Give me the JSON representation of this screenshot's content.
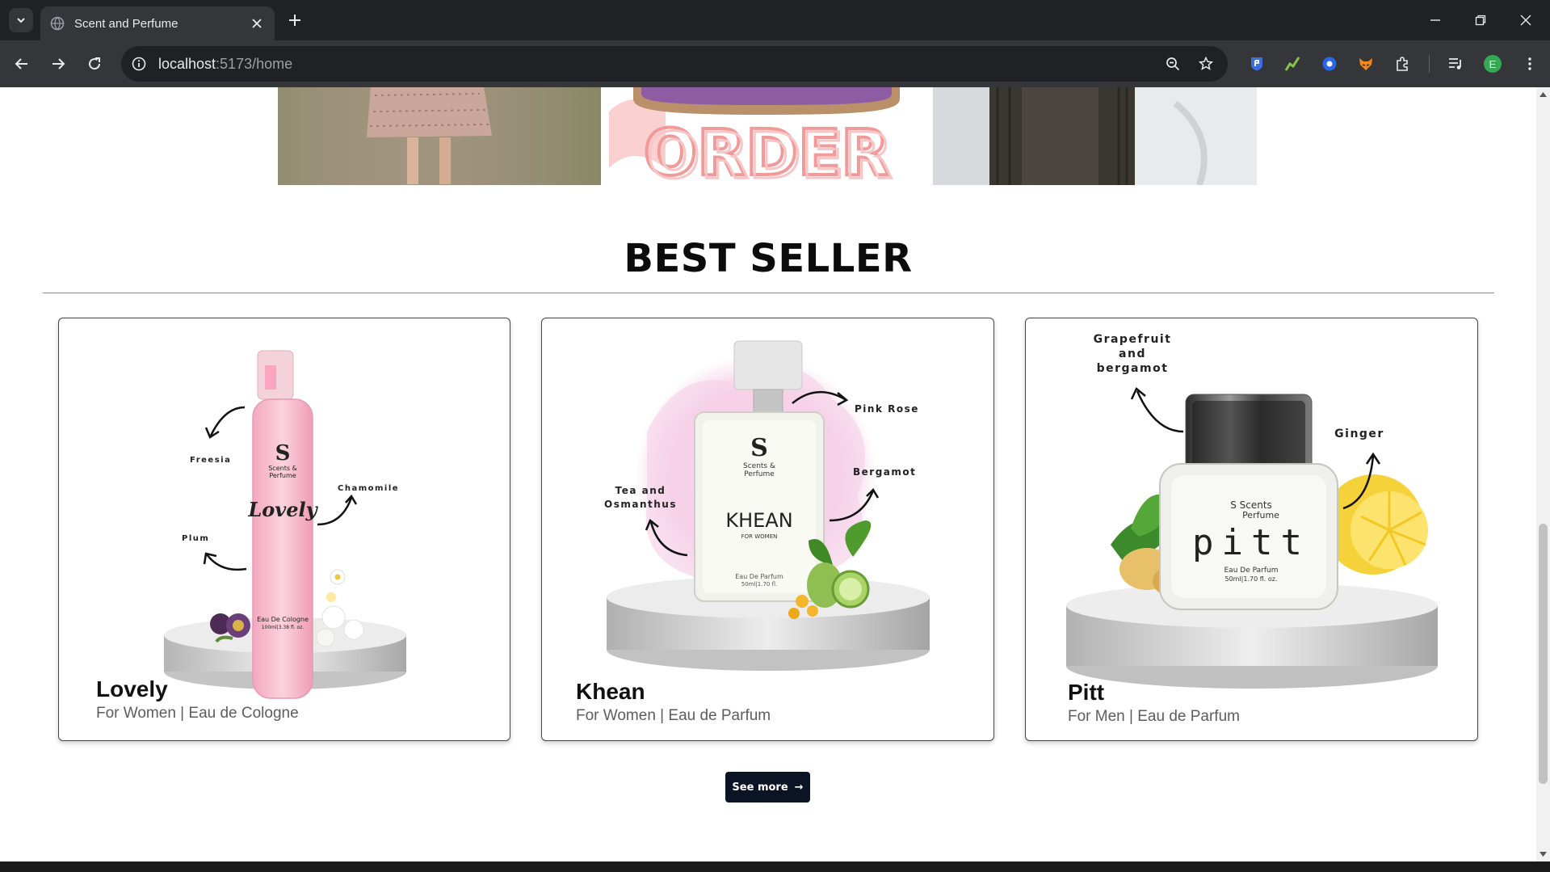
{
  "browser": {
    "tab_title": "Scent and Perfume",
    "url_host": "localhost",
    "url_path": ":5173/home",
    "profile_initial": "E"
  },
  "section": {
    "title": "BEST SELLER"
  },
  "products": [
    {
      "name": "Lovely",
      "subtitle": "For Women | Eau de Cologne",
      "brand": "Scents & Perfume",
      "label": "Lovely",
      "bottle_text": "Eau De Cologne",
      "bottle_volume": "100ml|3.38 fl. oz.",
      "notes": [
        "Freesia",
        "Chamomile",
        "Plum"
      ]
    },
    {
      "name": "Khean",
      "subtitle": "For Women | Eau de Parfum",
      "brand": "Scents & Perfume",
      "label": "KHEAN",
      "bottle_sublabel": "FOR WOMEN",
      "bottle_text": "Eau De Parfum",
      "bottle_volume": "50ml|1.70 fl.",
      "notes": [
        "Pink Rose",
        "Bergamot",
        "Tea and",
        "Osmanthus"
      ]
    },
    {
      "name": "Pitt",
      "subtitle": "For Men | Eau de Parfum",
      "brand": "Scents Perfume",
      "label": "pitt",
      "bottle_text": "Eau De Parfum",
      "bottle_volume": "50ml|1.70 fl. oz.",
      "notes": [
        "Grapefruit",
        "and",
        "bergamot",
        "Ginger"
      ]
    }
  ],
  "cta": {
    "label": "See more",
    "arrow": "→"
  },
  "colors": {
    "chrome_dark": "#202124",
    "chrome_toolbar": "#35363a",
    "button_bg": "#0b1424",
    "heading": "#0c0c0c"
  },
  "icons": [
    "tab-search-icon",
    "globe-icon",
    "close-icon",
    "plus-icon",
    "minimize-icon",
    "restore-icon",
    "window-close-icon",
    "back-icon",
    "forward-icon",
    "reload-icon",
    "site-info-icon",
    "zoom-icon",
    "star-icon",
    "extension-icon",
    "puzzle-icon",
    "media-icon",
    "profile-icon",
    "menu-icon"
  ]
}
